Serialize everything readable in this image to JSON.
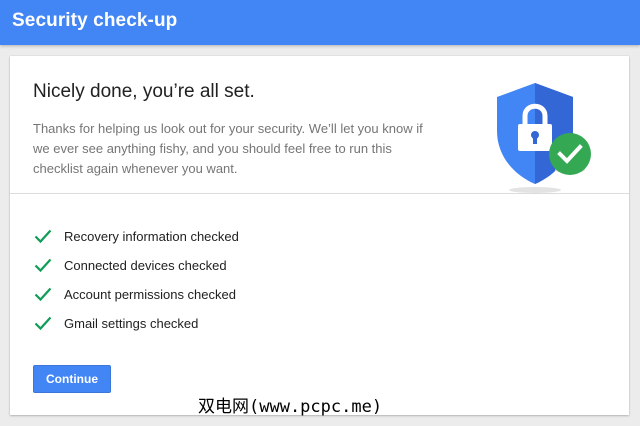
{
  "header": {
    "title": "Security check-up"
  },
  "main": {
    "headline": "Nicely done, you’re all set.",
    "description": "Thanks for helping us look out for your security. We’ll let you know if we ever see anything fishy, and you should feel free to run this checklist again whenever you want.",
    "illustration": {
      "icon": "shield-lock-check-icon",
      "shield_color": "#4285f4",
      "check_color": "#34a853"
    },
    "checklist": [
      {
        "label": "Recovery information checked",
        "icon": "checkmark-icon"
      },
      {
        "label": "Connected devices checked",
        "icon": "checkmark-icon"
      },
      {
        "label": "Account permissions checked",
        "icon": "checkmark-icon"
      },
      {
        "label": "Gmail settings checked",
        "icon": "checkmark-icon"
      }
    ],
    "continue_label": "Continue"
  },
  "watermark": "双电网(www.pcpc.me)",
  "colors": {
    "accent": "#4285f4",
    "success": "#0f9d58"
  }
}
